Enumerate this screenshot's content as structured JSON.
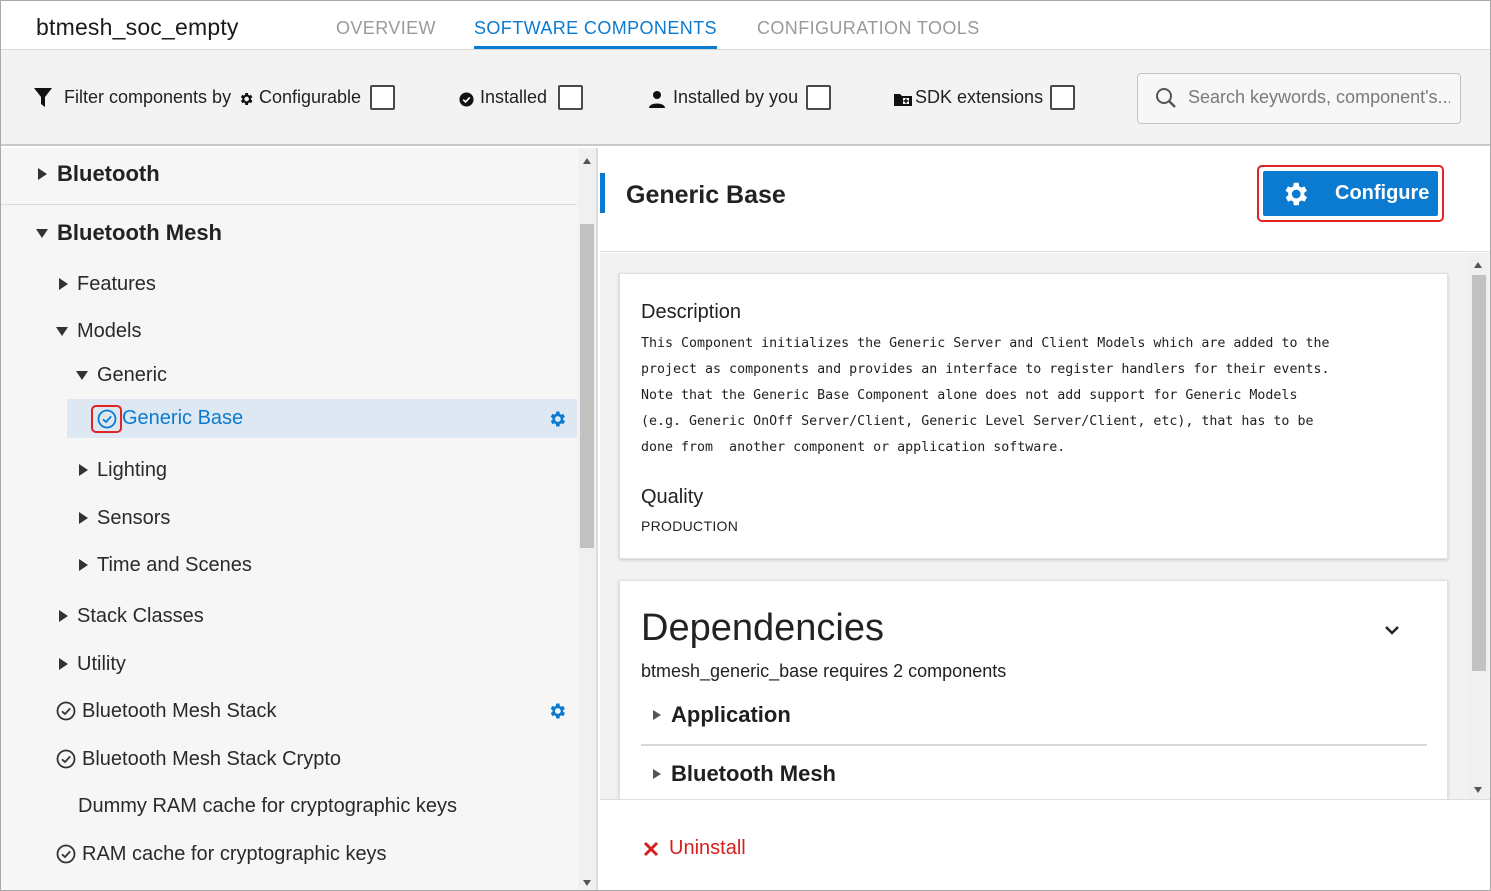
{
  "app": {
    "title": "btmesh_soc_empty"
  },
  "tabs": [
    {
      "label": "OVERVIEW",
      "active": false
    },
    {
      "label": "SOFTWARE COMPONENTS",
      "active": true
    },
    {
      "label": "CONFIGURATION TOOLS",
      "active": false
    }
  ],
  "filters": {
    "label": "Filter components by",
    "configurable": "Configurable",
    "installed": "Installed",
    "installed_by_you": "Installed by you",
    "sdk_extensions": "SDK extensions"
  },
  "search": {
    "placeholder": "Search keywords, component's..."
  },
  "tree": {
    "bluetooth": "Bluetooth",
    "bluetooth_mesh": "Bluetooth Mesh",
    "features": "Features",
    "models": "Models",
    "generic": "Generic",
    "generic_base": "Generic Base",
    "lighting": "Lighting",
    "sensors": "Sensors",
    "time_and_scenes": "Time and Scenes",
    "stack_classes": "Stack Classes",
    "utility": "Utility",
    "bt_mesh_stack": "Bluetooth Mesh Stack",
    "bt_mesh_stack_crypto": "Bluetooth Mesh Stack Crypto",
    "dummy_ram_cache": "Dummy RAM cache for cryptographic keys",
    "ram_cache": "RAM cache for cryptographic keys"
  },
  "component": {
    "title": "Generic Base",
    "configure_label": "Configure",
    "description_label": "Description",
    "description": "This Component initializes the Generic Server and Client Models which are added to the\nproject as components and provides an interface to register handlers for their events.\nNote that the Generic Base Component alone does not add support for Generic Models\n(e.g. Generic OnOff Server/Client, Generic Level Server/Client, etc), that has to be\ndone from  another component or application software.",
    "quality_label": "Quality",
    "quality": "PRODUCTION"
  },
  "dependencies": {
    "title": "Dependencies",
    "summary": "btmesh_generic_base requires 2 components",
    "items": [
      "Application",
      "Bluetooth Mesh"
    ]
  },
  "footer": {
    "uninstall_label": "Uninstall"
  },
  "colors": {
    "accent": "#0a7bd1",
    "highlight": "#e02424",
    "danger": "#d61f1f",
    "selected_row": "#dde8f2"
  }
}
